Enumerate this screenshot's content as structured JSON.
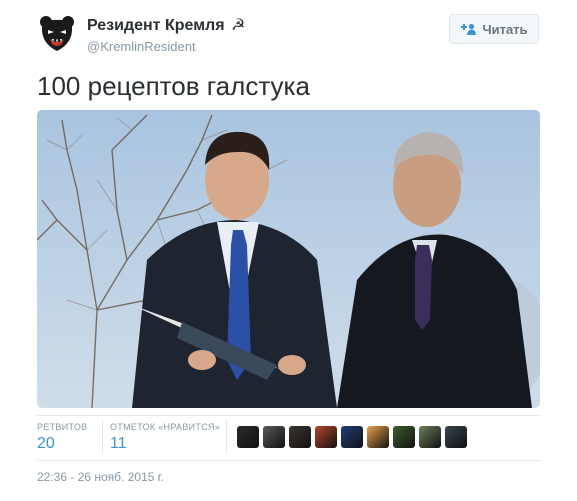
{
  "user": {
    "display_name": "Резидент Кремля",
    "name_symbol": "☭",
    "handle": "@KremlinResident"
  },
  "follow_button": {
    "label": "Читать",
    "icon": "add-user-icon"
  },
  "tweet": {
    "text": "100 рецептов галстука"
  },
  "photo": {
    "description_icon": "photo"
  },
  "stats": {
    "retweets_label": "РЕТВИТОВ",
    "retweets_value": "20",
    "likes_label": "ОТМЕТОК «НРАВИТСЯ»",
    "likes_value": "11"
  },
  "likers": [
    {
      "color": "#2a2a2a"
    },
    {
      "color": "#5a5a5a"
    },
    {
      "color": "#3d3530"
    },
    {
      "color": "#b5452c"
    },
    {
      "color": "#1f3f7a"
    },
    {
      "color": "#e8a24a"
    },
    {
      "color": "#3e5d2b"
    },
    {
      "color": "#6b7f5a"
    },
    {
      "color": "#37474f"
    }
  ],
  "timestamp": "22:36 - 26 нояб. 2015 г.",
  "colors": {
    "link_blue": "#3b94d9",
    "muted_gray": "#8899a6",
    "text_dark": "#292f33"
  }
}
